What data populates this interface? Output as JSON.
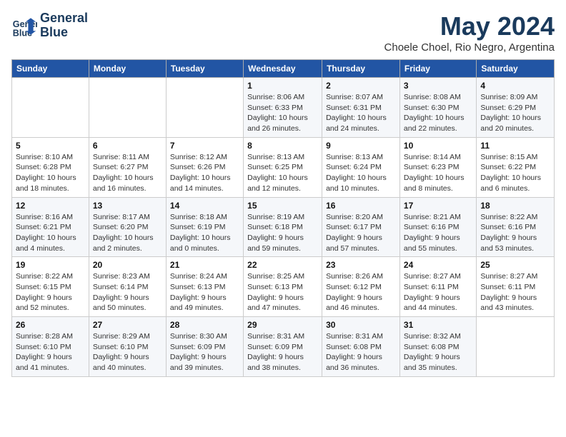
{
  "header": {
    "logo_line1": "General",
    "logo_line2": "Blue",
    "month_title": "May 2024",
    "location": "Choele Choel, Rio Negro, Argentina"
  },
  "days_of_week": [
    "Sunday",
    "Monday",
    "Tuesday",
    "Wednesday",
    "Thursday",
    "Friday",
    "Saturday"
  ],
  "weeks": [
    [
      {
        "day": "",
        "info": ""
      },
      {
        "day": "",
        "info": ""
      },
      {
        "day": "",
        "info": ""
      },
      {
        "day": "1",
        "info": "Sunrise: 8:06 AM\nSunset: 6:33 PM\nDaylight: 10 hours and 26 minutes."
      },
      {
        "day": "2",
        "info": "Sunrise: 8:07 AM\nSunset: 6:31 PM\nDaylight: 10 hours and 24 minutes."
      },
      {
        "day": "3",
        "info": "Sunrise: 8:08 AM\nSunset: 6:30 PM\nDaylight: 10 hours and 22 minutes."
      },
      {
        "day": "4",
        "info": "Sunrise: 8:09 AM\nSunset: 6:29 PM\nDaylight: 10 hours and 20 minutes."
      }
    ],
    [
      {
        "day": "5",
        "info": "Sunrise: 8:10 AM\nSunset: 6:28 PM\nDaylight: 10 hours and 18 minutes."
      },
      {
        "day": "6",
        "info": "Sunrise: 8:11 AM\nSunset: 6:27 PM\nDaylight: 10 hours and 16 minutes."
      },
      {
        "day": "7",
        "info": "Sunrise: 8:12 AM\nSunset: 6:26 PM\nDaylight: 10 hours and 14 minutes."
      },
      {
        "day": "8",
        "info": "Sunrise: 8:13 AM\nSunset: 6:25 PM\nDaylight: 10 hours and 12 minutes."
      },
      {
        "day": "9",
        "info": "Sunrise: 8:13 AM\nSunset: 6:24 PM\nDaylight: 10 hours and 10 minutes."
      },
      {
        "day": "10",
        "info": "Sunrise: 8:14 AM\nSunset: 6:23 PM\nDaylight: 10 hours and 8 minutes."
      },
      {
        "day": "11",
        "info": "Sunrise: 8:15 AM\nSunset: 6:22 PM\nDaylight: 10 hours and 6 minutes."
      }
    ],
    [
      {
        "day": "12",
        "info": "Sunrise: 8:16 AM\nSunset: 6:21 PM\nDaylight: 10 hours and 4 minutes."
      },
      {
        "day": "13",
        "info": "Sunrise: 8:17 AM\nSunset: 6:20 PM\nDaylight: 10 hours and 2 minutes."
      },
      {
        "day": "14",
        "info": "Sunrise: 8:18 AM\nSunset: 6:19 PM\nDaylight: 10 hours and 0 minutes."
      },
      {
        "day": "15",
        "info": "Sunrise: 8:19 AM\nSunset: 6:18 PM\nDaylight: 9 hours and 59 minutes."
      },
      {
        "day": "16",
        "info": "Sunrise: 8:20 AM\nSunset: 6:17 PM\nDaylight: 9 hours and 57 minutes."
      },
      {
        "day": "17",
        "info": "Sunrise: 8:21 AM\nSunset: 6:16 PM\nDaylight: 9 hours and 55 minutes."
      },
      {
        "day": "18",
        "info": "Sunrise: 8:22 AM\nSunset: 6:16 PM\nDaylight: 9 hours and 53 minutes."
      }
    ],
    [
      {
        "day": "19",
        "info": "Sunrise: 8:22 AM\nSunset: 6:15 PM\nDaylight: 9 hours and 52 minutes."
      },
      {
        "day": "20",
        "info": "Sunrise: 8:23 AM\nSunset: 6:14 PM\nDaylight: 9 hours and 50 minutes."
      },
      {
        "day": "21",
        "info": "Sunrise: 8:24 AM\nSunset: 6:13 PM\nDaylight: 9 hours and 49 minutes."
      },
      {
        "day": "22",
        "info": "Sunrise: 8:25 AM\nSunset: 6:13 PM\nDaylight: 9 hours and 47 minutes."
      },
      {
        "day": "23",
        "info": "Sunrise: 8:26 AM\nSunset: 6:12 PM\nDaylight: 9 hours and 46 minutes."
      },
      {
        "day": "24",
        "info": "Sunrise: 8:27 AM\nSunset: 6:11 PM\nDaylight: 9 hours and 44 minutes."
      },
      {
        "day": "25",
        "info": "Sunrise: 8:27 AM\nSunset: 6:11 PM\nDaylight: 9 hours and 43 minutes."
      }
    ],
    [
      {
        "day": "26",
        "info": "Sunrise: 8:28 AM\nSunset: 6:10 PM\nDaylight: 9 hours and 41 minutes."
      },
      {
        "day": "27",
        "info": "Sunrise: 8:29 AM\nSunset: 6:10 PM\nDaylight: 9 hours and 40 minutes."
      },
      {
        "day": "28",
        "info": "Sunrise: 8:30 AM\nSunset: 6:09 PM\nDaylight: 9 hours and 39 minutes."
      },
      {
        "day": "29",
        "info": "Sunrise: 8:31 AM\nSunset: 6:09 PM\nDaylight: 9 hours and 38 minutes."
      },
      {
        "day": "30",
        "info": "Sunrise: 8:31 AM\nSunset: 6:08 PM\nDaylight: 9 hours and 36 minutes."
      },
      {
        "day": "31",
        "info": "Sunrise: 8:32 AM\nSunset: 6:08 PM\nDaylight: 9 hours and 35 minutes."
      },
      {
        "day": "",
        "info": ""
      }
    ]
  ]
}
